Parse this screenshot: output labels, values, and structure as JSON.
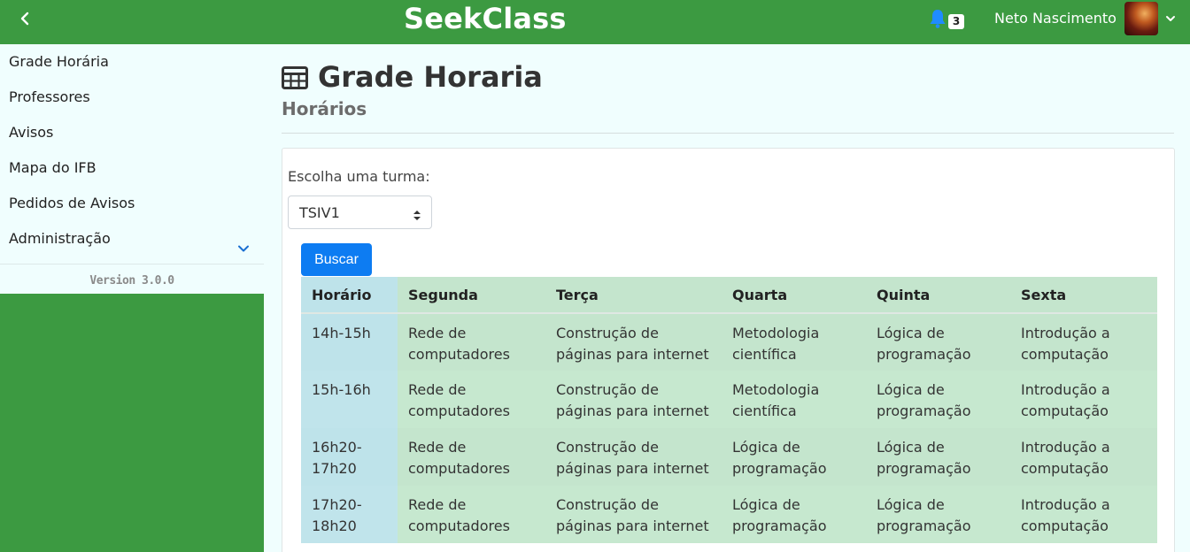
{
  "header": {
    "brand": "SeekClass",
    "notifications_count": "3",
    "user_name": "Neto Nascimento",
    "colors": {
      "bar": "#3c9a41",
      "bell": "#1f8cff"
    }
  },
  "sidebar": {
    "items": [
      {
        "label": "Grade Horária"
      },
      {
        "label": "Professores"
      },
      {
        "label": "Avisos"
      },
      {
        "label": "Mapa do IFB"
      },
      {
        "label": "Pedidos de Avisos"
      },
      {
        "label": "Administração",
        "icon": "chevron-down-icon"
      }
    ],
    "version": "Version 3.0.0"
  },
  "page": {
    "title": "Grade Horaria",
    "title_icon": "table-icon",
    "subtitle": "Horários"
  },
  "form": {
    "label": "Escolha uma turma:",
    "selected": "TSIV1",
    "button_label": "Buscar",
    "button_color": "#0d7cf2"
  },
  "schedule": {
    "headers": [
      "Horário",
      "Segunda",
      "Terça",
      "Quarta",
      "Quinta",
      "Sexta"
    ],
    "rows": [
      [
        "14h-15h",
        "Rede de computadores",
        "Construção de páginas para internet",
        "Metodologia científica",
        "Lógica de programação",
        "Introdução a computação"
      ],
      [
        "15h-16h",
        "Rede de computadores",
        "Construção de páginas para internet",
        "Metodologia científica",
        "Lógica de programação",
        "Introdução a computação"
      ],
      [
        "16h20-17h20",
        "Rede de computadores",
        "Construção de páginas para internet",
        "Lógica de programação",
        "Lógica de programação",
        "Introdução a computação"
      ],
      [
        "17h20-18h20",
        "Rede de computadores",
        "Construção de páginas para internet",
        "Lógica de programação",
        "Lógica de programação",
        "Introdução a computação"
      ]
    ]
  }
}
